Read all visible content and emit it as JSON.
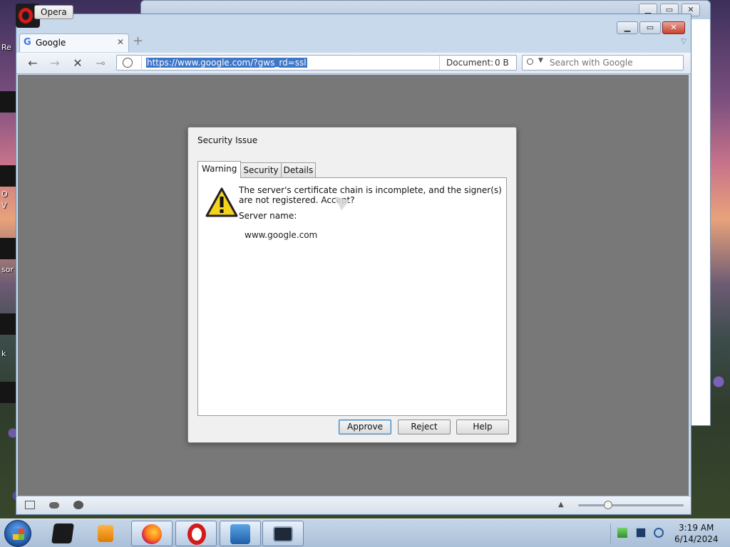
{
  "desktop": {
    "labels": [
      "Re",
      "O",
      "V",
      "sor",
      "k"
    ]
  },
  "opera": {
    "app_button": "Opera",
    "tab": {
      "favicon_letter": "G",
      "title": "Google",
      "close_glyph": "✕"
    },
    "new_tab_glyph": "+",
    "window_controls": {
      "minimize": "▁",
      "maximize": "▭",
      "close": "✕"
    },
    "nav": {
      "back": "←",
      "forward": "→",
      "stop": "✕",
      "key": "⊸"
    },
    "address": {
      "url": "https://www.google.com/?gws_rd=ssl",
      "document_label": "Document:",
      "document_size": "0 B"
    },
    "search": {
      "placeholder": "Search with Google"
    },
    "status": {
      "up_arrow": "▲"
    }
  },
  "dialog": {
    "title": "Security Issue",
    "tabs": [
      "Warning",
      "Security",
      "Details"
    ],
    "active_tab": "Warning",
    "message": "The server's certificate chain is incomplete, and the signer(s) are not registered. Accept?",
    "server_label": "Server name:",
    "server_name": "www.google.com",
    "buttons": {
      "approve": "Approve",
      "reject": "Reject",
      "help": "Help"
    }
  },
  "taskbar": {
    "clock": {
      "time": "3:19 AM",
      "date": "6/14/2024"
    }
  },
  "colors": {
    "url_highlight": "#3e76c8",
    "content_bg": "#787878",
    "opera_red": "#d41b1b",
    "warning_yellow": "#f5d31a"
  }
}
